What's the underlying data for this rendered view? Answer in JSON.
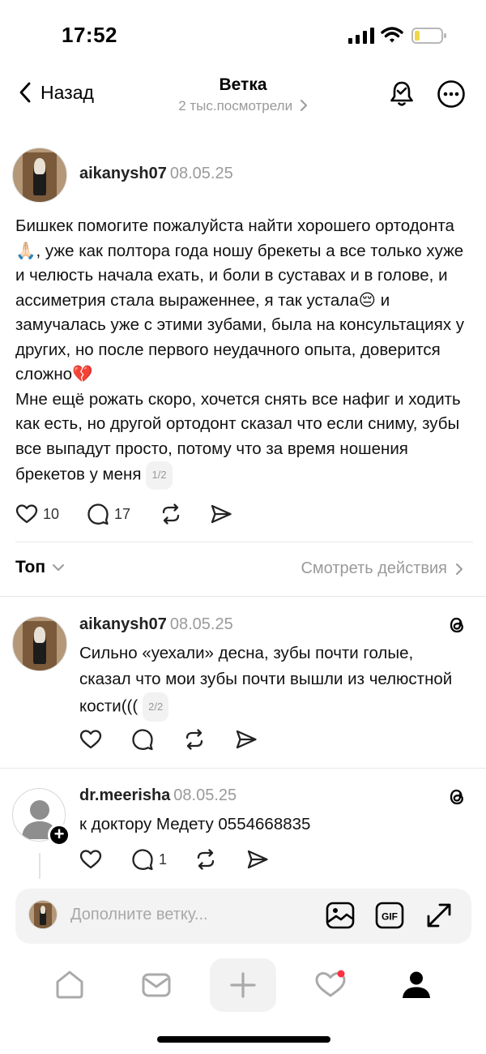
{
  "status_bar": {
    "time": "17:52"
  },
  "header": {
    "back_label": "Назад",
    "title": "Ветка",
    "subtitle": "2 тыс.посмотрели"
  },
  "post": {
    "username": "aikanysh07",
    "date": "08.05.25",
    "paragraph1": "Бишкек помогите пожалуйста найти хорошего ортодонта🙏🏻, уже как полтора года ношу брекеты а все только хуже и челюсть начала ехать, и боли в суставах и в голове, и ассиметрия стала выраженнее, я так устала😔 и замучалась уже с этими зубами, была на консультациях у других, но после первого неудачного опыта, доверится сложно💔",
    "paragraph2": "Мне ещё рожать скоро, хочется снять все нафиг и ходить как есть, но другой ортодонт сказал что если сниму, зубы все выпадут просто, потому что за время ношения брекетов у меня",
    "pager": "1/2",
    "likes": "10",
    "comments": "17"
  },
  "sort": {
    "label": "Топ",
    "view_activity": "Смотреть действия"
  },
  "replies": [
    {
      "username": "aikanysh07",
      "date": "08.05.25",
      "text": "Сильно «уехали» десна, зубы почти голые, сказал что мои зубы почти вышли из челюстной кости(((",
      "pager": "2/2",
      "likes": "",
      "comments": ""
    },
    {
      "username": "dr.meerisha",
      "date": "08.05.25",
      "text": "к доктору Медету 0554668835",
      "likes": "",
      "comments": "1"
    }
  ],
  "compose": {
    "placeholder": "Дополните ветку..."
  },
  "colors": {
    "text": "#000000",
    "muted": "#9a9a9a",
    "notification_dot": "#ff3040",
    "compose_bg": "#f3f3f3"
  },
  "icons": [
    "back-chevron-icon",
    "bell-icon",
    "more-icon",
    "heart-icon",
    "comment-icon",
    "repost-icon",
    "share-icon",
    "threads-icon",
    "image-icon",
    "gif-icon",
    "expand-icon",
    "home-icon",
    "messages-icon",
    "plus-icon",
    "activity-icon",
    "profile-icon"
  ]
}
